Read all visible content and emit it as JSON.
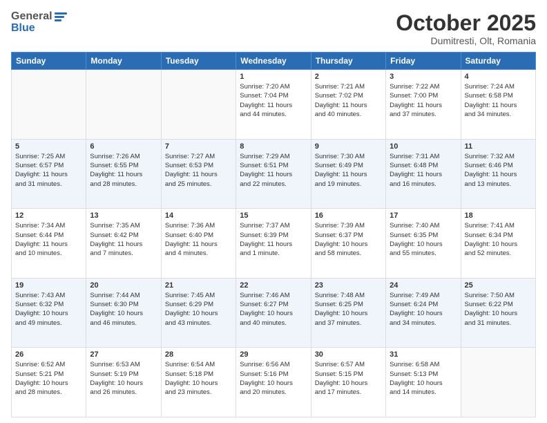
{
  "header": {
    "logo_general": "General",
    "logo_blue": "Blue",
    "month_title": "October 2025",
    "location": "Dumitresti, Olt, Romania"
  },
  "weekdays": [
    "Sunday",
    "Monday",
    "Tuesday",
    "Wednesday",
    "Thursday",
    "Friday",
    "Saturday"
  ],
  "weeks": [
    [
      {
        "day": "",
        "info": ""
      },
      {
        "day": "",
        "info": ""
      },
      {
        "day": "",
        "info": ""
      },
      {
        "day": "1",
        "info": "Sunrise: 7:20 AM\nSunset: 7:04 PM\nDaylight: 11 hours\nand 44 minutes."
      },
      {
        "day": "2",
        "info": "Sunrise: 7:21 AM\nSunset: 7:02 PM\nDaylight: 11 hours\nand 40 minutes."
      },
      {
        "day": "3",
        "info": "Sunrise: 7:22 AM\nSunset: 7:00 PM\nDaylight: 11 hours\nand 37 minutes."
      },
      {
        "day": "4",
        "info": "Sunrise: 7:24 AM\nSunset: 6:58 PM\nDaylight: 11 hours\nand 34 minutes."
      }
    ],
    [
      {
        "day": "5",
        "info": "Sunrise: 7:25 AM\nSunset: 6:57 PM\nDaylight: 11 hours\nand 31 minutes."
      },
      {
        "day": "6",
        "info": "Sunrise: 7:26 AM\nSunset: 6:55 PM\nDaylight: 11 hours\nand 28 minutes."
      },
      {
        "day": "7",
        "info": "Sunrise: 7:27 AM\nSunset: 6:53 PM\nDaylight: 11 hours\nand 25 minutes."
      },
      {
        "day": "8",
        "info": "Sunrise: 7:29 AM\nSunset: 6:51 PM\nDaylight: 11 hours\nand 22 minutes."
      },
      {
        "day": "9",
        "info": "Sunrise: 7:30 AM\nSunset: 6:49 PM\nDaylight: 11 hours\nand 19 minutes."
      },
      {
        "day": "10",
        "info": "Sunrise: 7:31 AM\nSunset: 6:48 PM\nDaylight: 11 hours\nand 16 minutes."
      },
      {
        "day": "11",
        "info": "Sunrise: 7:32 AM\nSunset: 6:46 PM\nDaylight: 11 hours\nand 13 minutes."
      }
    ],
    [
      {
        "day": "12",
        "info": "Sunrise: 7:34 AM\nSunset: 6:44 PM\nDaylight: 11 hours\nand 10 minutes."
      },
      {
        "day": "13",
        "info": "Sunrise: 7:35 AM\nSunset: 6:42 PM\nDaylight: 11 hours\nand 7 minutes."
      },
      {
        "day": "14",
        "info": "Sunrise: 7:36 AM\nSunset: 6:40 PM\nDaylight: 11 hours\nand 4 minutes."
      },
      {
        "day": "15",
        "info": "Sunrise: 7:37 AM\nSunset: 6:39 PM\nDaylight: 11 hours\nand 1 minute."
      },
      {
        "day": "16",
        "info": "Sunrise: 7:39 AM\nSunset: 6:37 PM\nDaylight: 10 hours\nand 58 minutes."
      },
      {
        "day": "17",
        "info": "Sunrise: 7:40 AM\nSunset: 6:35 PM\nDaylight: 10 hours\nand 55 minutes."
      },
      {
        "day": "18",
        "info": "Sunrise: 7:41 AM\nSunset: 6:34 PM\nDaylight: 10 hours\nand 52 minutes."
      }
    ],
    [
      {
        "day": "19",
        "info": "Sunrise: 7:43 AM\nSunset: 6:32 PM\nDaylight: 10 hours\nand 49 minutes."
      },
      {
        "day": "20",
        "info": "Sunrise: 7:44 AM\nSunset: 6:30 PM\nDaylight: 10 hours\nand 46 minutes."
      },
      {
        "day": "21",
        "info": "Sunrise: 7:45 AM\nSunset: 6:29 PM\nDaylight: 10 hours\nand 43 minutes."
      },
      {
        "day": "22",
        "info": "Sunrise: 7:46 AM\nSunset: 6:27 PM\nDaylight: 10 hours\nand 40 minutes."
      },
      {
        "day": "23",
        "info": "Sunrise: 7:48 AM\nSunset: 6:25 PM\nDaylight: 10 hours\nand 37 minutes."
      },
      {
        "day": "24",
        "info": "Sunrise: 7:49 AM\nSunset: 6:24 PM\nDaylight: 10 hours\nand 34 minutes."
      },
      {
        "day": "25",
        "info": "Sunrise: 7:50 AM\nSunset: 6:22 PM\nDaylight: 10 hours\nand 31 minutes."
      }
    ],
    [
      {
        "day": "26",
        "info": "Sunrise: 6:52 AM\nSunset: 5:21 PM\nDaylight: 10 hours\nand 28 minutes."
      },
      {
        "day": "27",
        "info": "Sunrise: 6:53 AM\nSunset: 5:19 PM\nDaylight: 10 hours\nand 26 minutes."
      },
      {
        "day": "28",
        "info": "Sunrise: 6:54 AM\nSunset: 5:18 PM\nDaylight: 10 hours\nand 23 minutes."
      },
      {
        "day": "29",
        "info": "Sunrise: 6:56 AM\nSunset: 5:16 PM\nDaylight: 10 hours\nand 20 minutes."
      },
      {
        "day": "30",
        "info": "Sunrise: 6:57 AM\nSunset: 5:15 PM\nDaylight: 10 hours\nand 17 minutes."
      },
      {
        "day": "31",
        "info": "Sunrise: 6:58 AM\nSunset: 5:13 PM\nDaylight: 10 hours\nand 14 minutes."
      },
      {
        "day": "",
        "info": ""
      }
    ]
  ]
}
